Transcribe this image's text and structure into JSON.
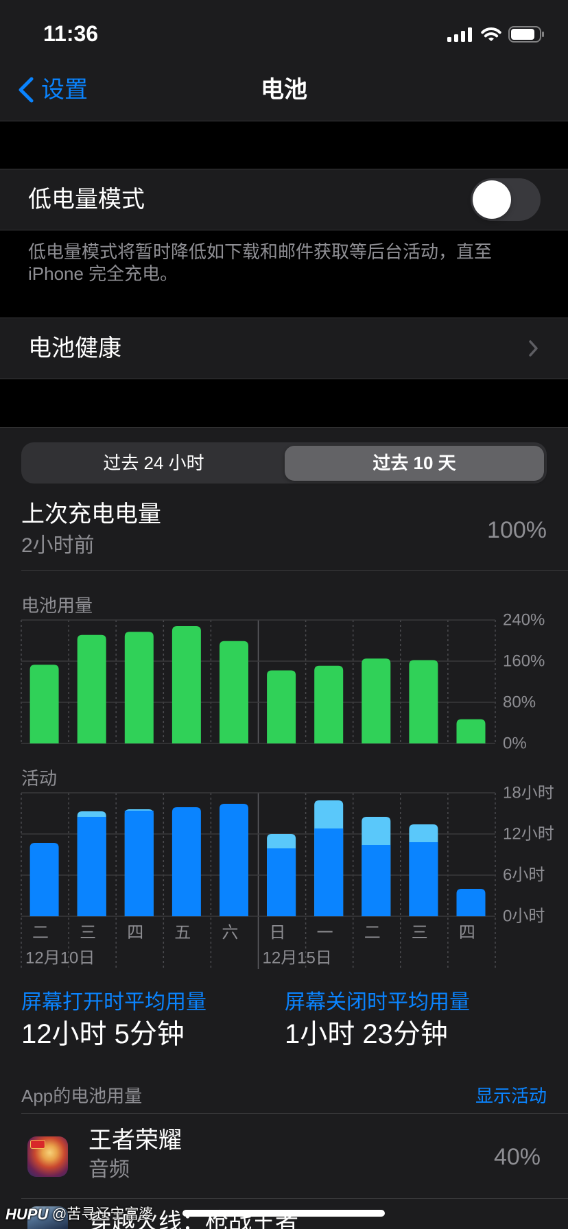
{
  "status_bar": {
    "time": "11:36",
    "signal_icon": "cellular-signal-icon",
    "wifi_icon": "wifi-icon",
    "battery_icon": "battery-icon",
    "battery_level": 0.85
  },
  "nav": {
    "back_label": "设置",
    "back_icon": "chevron-left-icon",
    "title": "电池"
  },
  "low_power_mode": {
    "label": "低电量模式",
    "enabled": false,
    "footer_lines": [
      "低电量模式将暂时降低如下载和邮件获取等后台活动，直至",
      "iPhone 完全充电。"
    ]
  },
  "battery_health": {
    "label": "电池健康",
    "icon": "chevron-right-icon"
  },
  "range_tabs": [
    {
      "label": "过去 24 小时",
      "selected": false
    },
    {
      "label": "过去 10 天",
      "selected": true
    }
  ],
  "last_charge": {
    "title": "上次充电电量",
    "subtitle": "2小时前",
    "value": "100%"
  },
  "chart_data": [
    {
      "type": "bar",
      "title": "电池用量",
      "categories": [
        "二",
        "三",
        "四",
        "五",
        "六",
        "日",
        "一",
        "二",
        "三",
        "四"
      ],
      "values": [
        153,
        211,
        217,
        228,
        199,
        142,
        151,
        165,
        162,
        47
      ],
      "ylim": [
        0,
        240
      ],
      "y_ticks": [
        240,
        160,
        80,
        0
      ],
      "y_tick_labels": [
        "240%",
        "160%",
        "80%",
        "0%"
      ],
      "grid": true,
      "color": "#30d158"
    },
    {
      "type": "bar",
      "stacked": true,
      "title": "活动",
      "categories": [
        "二",
        "三",
        "四",
        "五",
        "六",
        "日",
        "一",
        "二",
        "三",
        "四"
      ],
      "series": [
        {
          "values": [
            10.7,
            14.5,
            15.4,
            15.9,
            16.4,
            9.9,
            12.8,
            10.4,
            10.8,
            4.0
          ],
          "color": "#0a84ff"
        },
        {
          "values": [
            0,
            0.8,
            0.2,
            0,
            0,
            2.1,
            4.1,
            4.1,
            2.6,
            0
          ],
          "color": "#5ac8fa"
        }
      ],
      "ylim": [
        0,
        18
      ],
      "y_ticks": [
        18,
        12,
        6,
        0
      ],
      "y_tick_labels": [
        "18小时",
        "12小时",
        "6小时",
        "0小时"
      ],
      "date_labels": [
        {
          "category_index": 0,
          "label": "12月10日"
        },
        {
          "category_index": 5,
          "label": "12月15日"
        }
      ],
      "grid": true
    }
  ],
  "averages": {
    "screen_on_label": "屏幕打开时平均用量",
    "screen_on_value": "12小时 5分钟",
    "screen_off_label": "屏幕关闭时平均用量",
    "screen_off_value": "1小时 23分钟"
  },
  "app_usage": {
    "header": "App的电池用量",
    "toggle_label": "显示活动",
    "apps": [
      {
        "name": "王者荣耀",
        "detail": "音频",
        "percent": "40%",
        "icon": "honor-of-kings-app-icon"
      },
      {
        "name": "穿越火线：枪战王者",
        "icon": "crossfire-app-icon"
      }
    ]
  },
  "watermark": {
    "brand": "HUPU",
    "handle": "@苦寻辽宁富婆"
  },
  "colors": {
    "background": "#000000",
    "cell": "#1c1c1e",
    "accent": "#0a84ff",
    "secondary_text": "#8e8e93",
    "battery_bar": "#30d158",
    "screen_on_bar": "#0a84ff",
    "screen_off_bar": "#5ac8fa"
  }
}
